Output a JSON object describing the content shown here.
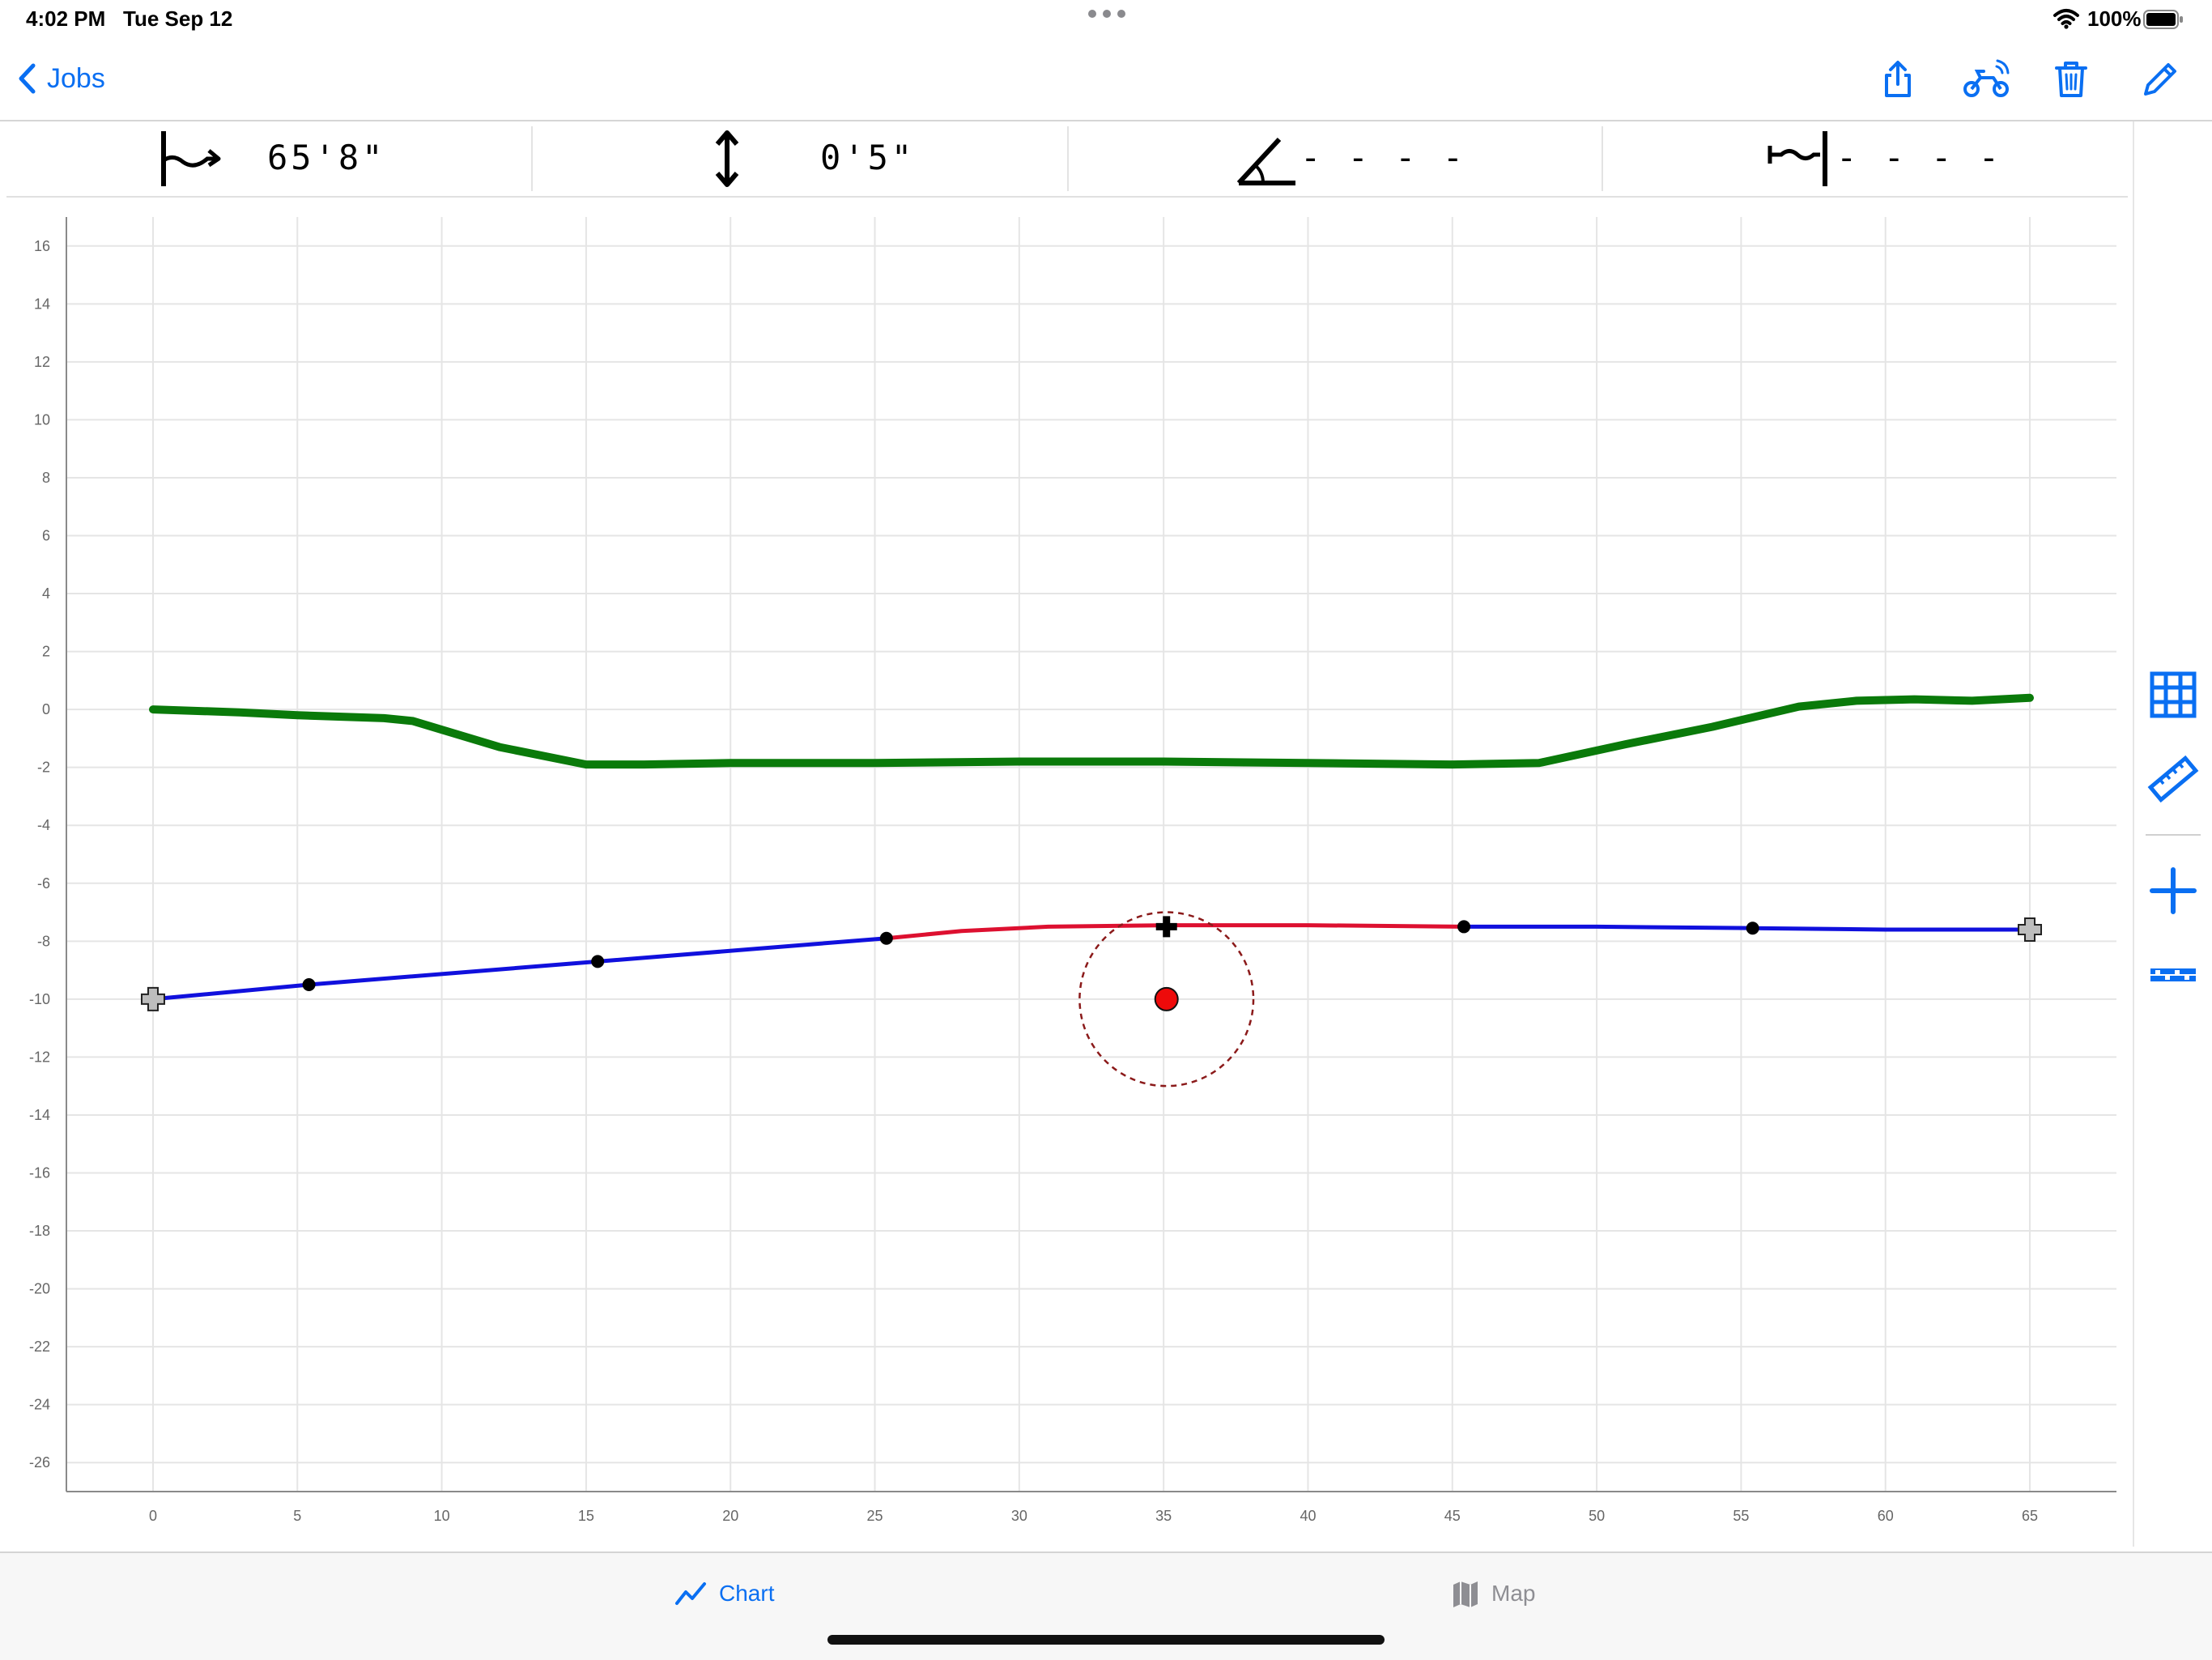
{
  "status_bar": {
    "time": "4:02 PM",
    "date": "Tue Sep 12",
    "battery": "100%"
  },
  "nav": {
    "back_label": "Jobs",
    "actions": [
      "share-icon",
      "scooter-signal-icon",
      "trash-icon",
      "pencil-icon"
    ],
    "accent_color": "#0a6ff2"
  },
  "metrics": [
    {
      "icon": "horizontal-distance-icon",
      "value": "65'8\""
    },
    {
      "icon": "vertical-distance-icon",
      "value": "0'5\""
    },
    {
      "icon": "angle-icon",
      "value": "- - - -"
    },
    {
      "icon": "offset-icon",
      "value": "- - - -"
    }
  ],
  "side_tools": [
    "grid-icon",
    "ruler-icon",
    "plus-icon",
    "checkered-strip-icon"
  ],
  "chart_data": {
    "type": "line",
    "title": "",
    "xlabel": "",
    "ylabel": "",
    "xlim": [
      -3,
      68
    ],
    "ylim": [
      -27,
      17
    ],
    "x_ticks": [
      0,
      5,
      10,
      15,
      20,
      25,
      30,
      35,
      40,
      45,
      50,
      55,
      60,
      65
    ],
    "y_ticks": [
      16,
      14,
      12,
      10,
      8,
      6,
      4,
      2,
      0,
      -2,
      -4,
      -6,
      -8,
      -10,
      -12,
      -14,
      -16,
      -18,
      -20,
      -22,
      -24,
      -26
    ],
    "grid": true,
    "series": [
      {
        "color": "#0a7a0a",
        "points": [
          [
            0,
            0
          ],
          [
            3,
            -0.1
          ],
          [
            5,
            -0.2
          ],
          [
            8,
            -0.3
          ],
          [
            9,
            -0.4
          ],
          [
            12,
            -1.3
          ],
          [
            15,
            -1.9
          ],
          [
            17,
            -1.9
          ],
          [
            20,
            -1.85
          ],
          [
            25,
            -1.85
          ],
          [
            30,
            -1.8
          ],
          [
            35,
            -1.8
          ],
          [
            40,
            -1.85
          ],
          [
            45,
            -1.9
          ],
          [
            48,
            -1.85
          ],
          [
            51,
            -1.2
          ],
          [
            54,
            -0.6
          ],
          [
            57,
            0.1
          ],
          [
            59,
            0.3
          ],
          [
            61,
            0.35
          ],
          [
            63,
            0.3
          ],
          [
            65,
            0.4
          ]
        ]
      },
      {
        "color": "#1010dd",
        "points": [
          [
            0,
            -10
          ],
          [
            5.4,
            -9.5
          ],
          [
            15.4,
            -8.7
          ],
          [
            25.4,
            -7.9
          ]
        ]
      },
      {
        "color": "#dd1030",
        "points": [
          [
            25.4,
            -7.9
          ],
          [
            28,
            -7.65
          ],
          [
            31,
            -7.5
          ],
          [
            35.2,
            -7.45
          ],
          [
            40,
            -7.45
          ],
          [
            45.4,
            -7.5
          ]
        ]
      },
      {
        "color": "#1010dd",
        "points": [
          [
            45.4,
            -7.5
          ],
          [
            50,
            -7.5
          ],
          [
            55.4,
            -7.55
          ],
          [
            60,
            -7.6
          ],
          [
            65,
            -7.6
          ]
        ]
      }
    ],
    "control_points": [
      [
        5.4,
        -9.5
      ],
      [
        15.4,
        -8.7
      ],
      [
        25.4,
        -7.9
      ],
      [
        45.4,
        -7.5
      ],
      [
        55.4,
        -7.55
      ]
    ],
    "end_points": [
      [
        0,
        -10
      ],
      [
        65,
        -7.6
      ]
    ],
    "target_point": [
      35.1,
      -10.0
    ],
    "target_marker": [
      35.1,
      -7.5
    ],
    "target_radius": 3
  },
  "tabs": [
    {
      "label": "Chart",
      "icon": "chart-line-icon",
      "active": true
    },
    {
      "label": "Map",
      "icon": "map-icon",
      "active": false
    }
  ]
}
